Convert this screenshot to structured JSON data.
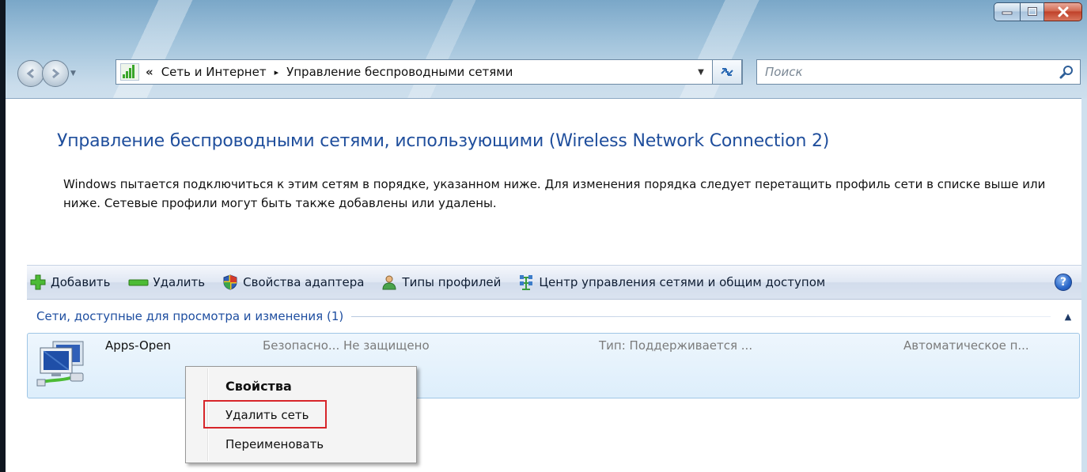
{
  "window": {
    "caption_buttons": [
      "minimize",
      "maximize",
      "close"
    ]
  },
  "address_bar": {
    "overflow_chevron": "«",
    "segments": [
      "Сеть и Интернет",
      "Управление беспроводными сетями"
    ],
    "separator": "▸"
  },
  "search": {
    "placeholder": "Поиск"
  },
  "page": {
    "title": "Управление беспроводными сетями, использующими (Wireless Network Connection 2)",
    "description": "Windows пытается подключиться к этим сетям в порядке, указанном ниже. Для изменения порядка следует перетащить профиль сети в списке выше или ниже. Сетевые профили могут быть также добавлены или удалены."
  },
  "toolbar": {
    "add": "Добавить",
    "remove": "Удалить",
    "adapter_properties": "Свойства адаптера",
    "profile_types": "Типы профилей",
    "network_center": "Центр управления сетями и общим доступом"
  },
  "group": {
    "title": "Сети, доступные для просмотра и изменения (1)"
  },
  "networks": [
    {
      "name": "Apps-Open",
      "security": "Безопасно... Не защищено",
      "type": "Тип: Поддерживается ...",
      "mode": "Автоматическое п..."
    }
  ],
  "context_menu": {
    "items": [
      "Свойства",
      "Удалить сеть",
      "Переименовать"
    ],
    "highlighted_item": "Удалить сеть"
  },
  "colors": {
    "title_blue": "#1f4e9c",
    "link_blue": "#1e4ea0",
    "highlight_red": "#d7252a",
    "selection_bg": "#ddeefb"
  }
}
